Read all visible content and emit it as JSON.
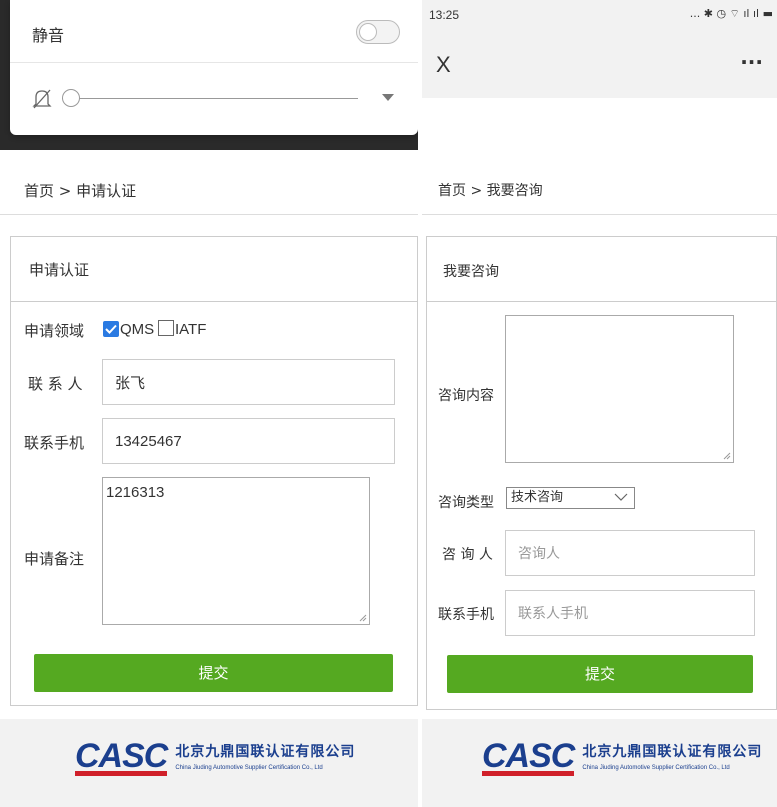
{
  "left": {
    "notification": {
      "title": "静音",
      "slider_percent": 0
    },
    "breadcrumb": "首页 > 申请认证",
    "box_title": "申请认证",
    "form": {
      "domain_label": "申请领域",
      "checkbox_qms": "QMS",
      "checkbox_iatf": "IATF",
      "contact_label": "联 系 人",
      "contact_value": "张飞",
      "phone_label": "联系手机",
      "phone_value": "13425467",
      "remark_label": "申请备注",
      "remark_value": "1216313",
      "submit": "提交"
    },
    "footer": {
      "logo_text": "CASC",
      "company_cn": "北京九鼎国联认证有限公司",
      "company_en": "China Jiuding Automotive Supplier Certification Co., Ltd"
    }
  },
  "right": {
    "status_bar": {
      "time": "13:25",
      "icons": "... ✱ ◷ ⌔ ıl ıl ▬"
    },
    "nav": {
      "close": "X",
      "more": "···"
    },
    "breadcrumb": "首页 > 我要咨询",
    "box_title": "我要咨询",
    "form": {
      "content_label": "咨询内容",
      "type_label": "咨询类型",
      "type_value": "技术咨询",
      "person_label": "咨 询 人",
      "person_placeholder": "咨询人",
      "phone_label": "联系手机",
      "phone_placeholder": "联系人手机",
      "submit": "提交"
    },
    "footer": {
      "logo_text": "CASC",
      "company_cn": "北京九鼎国联认证有限公司",
      "company_en": "China Jiuding Automotive Supplier Certification Co., Ltd"
    }
  },
  "colors": {
    "submit_green": "#55a921",
    "checkbox_blue": "#2a7ae2",
    "logo_blue": "#1b3f8e",
    "logo_red": "#d0202a"
  }
}
